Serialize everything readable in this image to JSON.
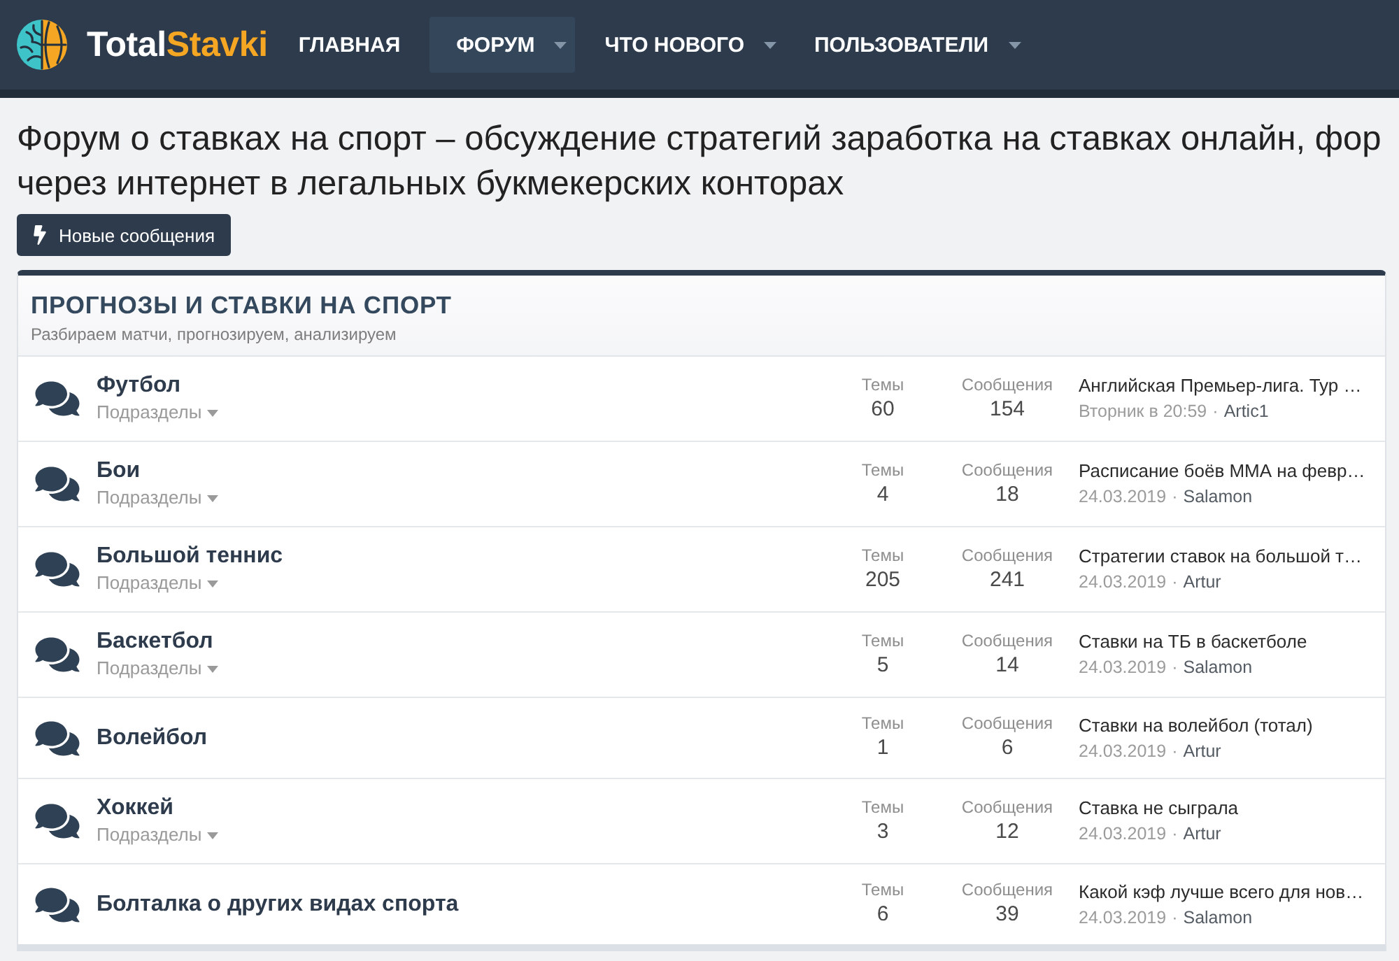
{
  "header": {
    "logo": {
      "text": "Total",
      "accent": "Stavki"
    },
    "nav": [
      {
        "label": "ГЛАВНАЯ",
        "selected": false,
        "has_menu": false
      },
      {
        "label": "ФОРУМ",
        "selected": true,
        "has_menu": true
      },
      {
        "label": "ЧТО НОВОГО",
        "selected": false,
        "has_menu": true
      },
      {
        "label": "ПОЛЬЗОВАТЕЛИ",
        "selected": false,
        "has_menu": true
      }
    ]
  },
  "page_title": [
    "Форум о ставках на спорт – обсуждение стратегий заработка на ставках онлайн, фор",
    "через интернет в легальных букмекерских конторах"
  ],
  "new_posts_button": {
    "label": "Новые сообщения"
  },
  "category": {
    "title": "ПРОГНОЗЫ И СТАВКИ НА СПОРТ",
    "description": "Разбираем матчи, прогнозируем, анализируем",
    "forums": [
      {
        "title": "Футбол",
        "subforums": "Подразделы",
        "topics_label": "Темы",
        "topics": "60",
        "messages_label": "Сообщения",
        "messages": "154",
        "last_post": {
          "title": "Английская Премьер-лига. Тур …",
          "date": "Вторник в 20:59",
          "separator": "·",
          "author": "Artic1"
        }
      },
      {
        "title": "Бои",
        "subforums": "Подразделы",
        "topics_label": "Темы",
        "topics": "4",
        "messages_label": "Сообщения",
        "messages": "18",
        "last_post": {
          "title": "Расписание боёв ММА на февр…",
          "date": "24.03.2019",
          "separator": "·",
          "author": "Salamon"
        }
      },
      {
        "title": "Большой теннис",
        "subforums": "Подразделы",
        "topics_label": "Темы",
        "topics": "205",
        "messages_label": "Сообщения",
        "messages": "241",
        "last_post": {
          "title": "Стратегии ставок на большой т…",
          "date": "24.03.2019",
          "separator": "·",
          "author": "Artur"
        }
      },
      {
        "title": "Баскетбол",
        "subforums": "Подразделы",
        "topics_label": "Темы",
        "topics": "5",
        "messages_label": "Сообщения",
        "messages": "14",
        "last_post": {
          "title": "Ставки на ТБ в баскетболе",
          "date": "24.03.2019",
          "separator": "·",
          "author": "Salamon"
        }
      },
      {
        "title": "Волейбол",
        "topics_label": "Темы",
        "topics": "1",
        "messages_label": "Сообщения",
        "messages": "6",
        "last_post": {
          "title": "Ставки на волейбол (тотал)",
          "date": "24.03.2019",
          "separator": "·",
          "author": "Artur"
        }
      },
      {
        "title": "Хоккей",
        "subforums": "Подразделы",
        "topics_label": "Темы",
        "topics": "3",
        "messages_label": "Сообщения",
        "messages": "12",
        "last_post": {
          "title": "Ставка не сыграла",
          "date": "24.03.2019",
          "separator": "·",
          "author": "Artur"
        }
      },
      {
        "title": "Болталка о других видах спорта",
        "topics_label": "Темы",
        "topics": "6",
        "messages_label": "Сообщения",
        "messages": "39",
        "last_post": {
          "title": "Какой кэф лучше всего для нов…",
          "date": "24.03.2019",
          "separator": "·",
          "author": "Salamon"
        }
      }
    ]
  }
}
